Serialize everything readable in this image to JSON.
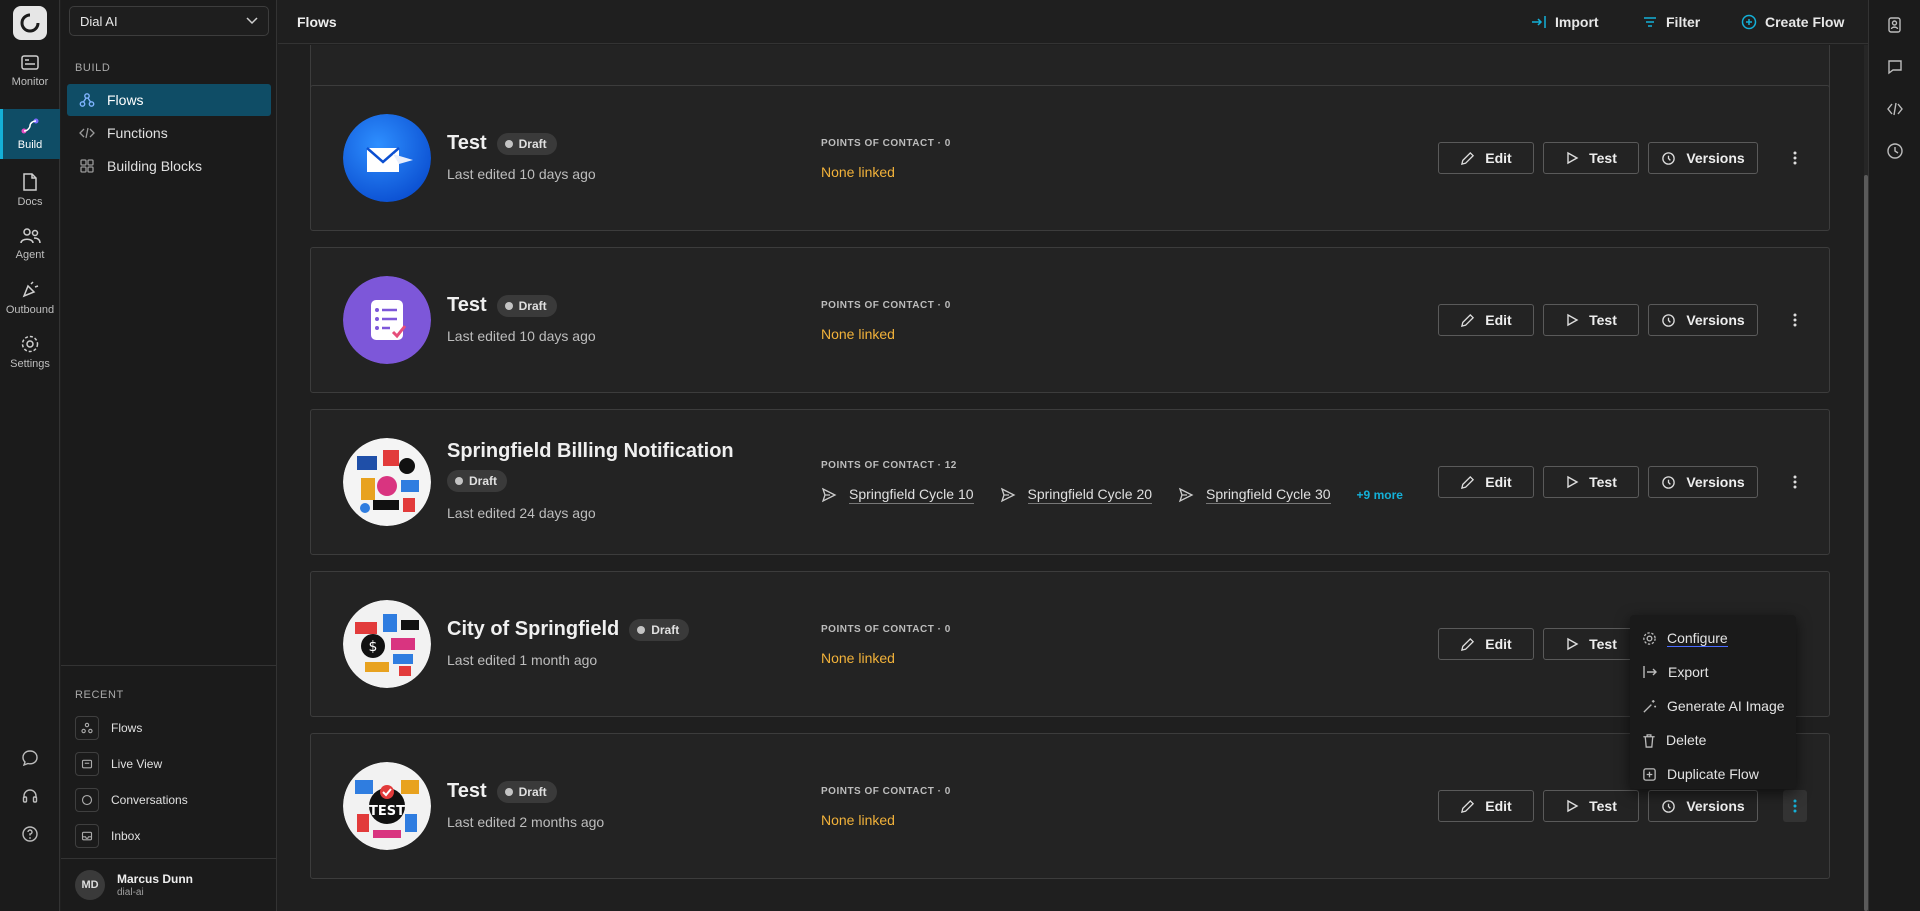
{
  "app": {
    "workspace": "Dial AI",
    "page_title": "Flows"
  },
  "rail": [
    {
      "label": "Monitor",
      "icon": "monitor-icon"
    },
    {
      "label": "Build",
      "icon": "build-icon",
      "active": true
    },
    {
      "label": "Docs",
      "icon": "docs-icon"
    },
    {
      "label": "Agent",
      "icon": "agent-icon"
    },
    {
      "label": "Outbound",
      "icon": "outbound-icon"
    },
    {
      "label": "Settings",
      "icon": "settings-icon"
    }
  ],
  "sidebar": {
    "build_label": "BUILD",
    "items": [
      {
        "label": "Flows",
        "icon": "flows-icon",
        "active": true
      },
      {
        "label": "Functions",
        "icon": "code-icon"
      },
      {
        "label": "Building Blocks",
        "icon": "blocks-icon"
      }
    ],
    "recent_label": "RECENT",
    "recent": [
      {
        "label": "Flows",
        "icon": "flows-icon"
      },
      {
        "label": "Live View",
        "icon": "live-view-icon"
      },
      {
        "label": "Conversations",
        "icon": "chat-icon"
      },
      {
        "label": "Inbox",
        "icon": "inbox-icon"
      }
    ]
  },
  "user": {
    "initials": "MD",
    "name": "Marcus Dunn",
    "org": "dial-ai"
  },
  "header": {
    "import": "Import",
    "filter": "Filter",
    "create": "Create Flow"
  },
  "buttons": {
    "edit": "Edit",
    "test": "Test",
    "versions": "Versions"
  },
  "flows": [
    {
      "name": "Test",
      "status": "Draft",
      "edited": "Last edited 10 days ago",
      "poc_label": "POINTS OF CONTACT · 0",
      "none_linked": "None linked",
      "image": "email-icon"
    },
    {
      "name": "Test",
      "status": "Draft",
      "edited": "Last edited 10 days ago",
      "poc_label": "POINTS OF CONTACT · 0",
      "none_linked": "None linked",
      "image": "checklist-icon"
    },
    {
      "name": "Springfield Billing Notification",
      "status": "Draft",
      "edited": "Last edited 24 days ago",
      "poc_label": "POINTS OF CONTACT · 12",
      "contacts": [
        "Springfield Cycle 10",
        "Springfield Cycle 20",
        "Springfield Cycle 30"
      ],
      "more": "+9 more",
      "image": "generated-art"
    },
    {
      "name": "City of Springfield",
      "status": "Draft",
      "edited": "Last edited 1 month ago",
      "poc_label": "POINTS OF CONTACT · 0",
      "none_linked": "None linked",
      "image": "generated-art"
    },
    {
      "name": "Test",
      "status": "Draft",
      "edited": "Last edited 2 months ago",
      "poc_label": "POINTS OF CONTACT · 0",
      "none_linked": "None linked",
      "image": "generated-art-test",
      "image_text": "TEST"
    }
  ],
  "menu": [
    {
      "label": "Configure",
      "icon": "gear-icon"
    },
    {
      "label": "Export",
      "icon": "export-icon"
    },
    {
      "label": "Generate AI Image",
      "icon": "magic-wand-icon"
    },
    {
      "label": "Delete",
      "icon": "trash-icon"
    },
    {
      "label": "Duplicate Flow",
      "icon": "duplicate-icon"
    }
  ],
  "colors": {
    "accent": "#14b0d8",
    "active_bg": "#0f4d66",
    "warning": "#f2b23a"
  }
}
